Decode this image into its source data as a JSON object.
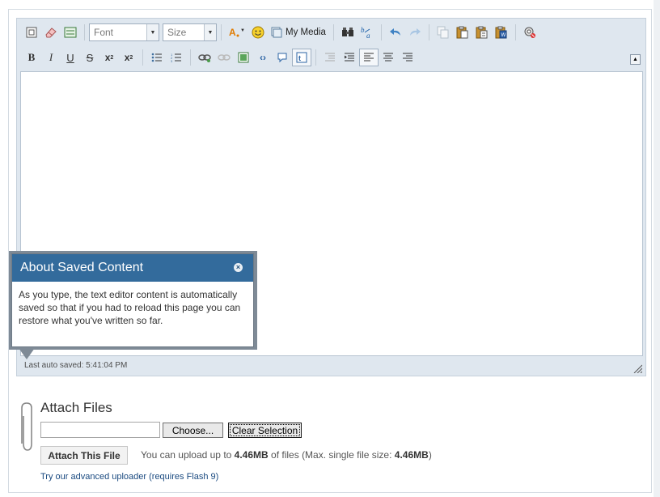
{
  "toolbar": {
    "font_label": "Font",
    "size_label": "Size",
    "my_media_label": "My Media",
    "row1_icons": [
      "source-icon",
      "eraser-icon",
      "template-icon",
      "text-color-icon",
      "smiley-icon",
      "find-icon",
      "spellcheck-icon",
      "undo-icon",
      "redo-icon",
      "copy-icon",
      "paste-icon",
      "paste-text-icon",
      "paste-word-icon",
      "settings-icon"
    ],
    "row2_icons": [
      "bold-icon",
      "italic-icon",
      "underline-icon",
      "strikethrough-icon",
      "subscript-icon",
      "superscript-icon",
      "bullet-list-icon",
      "numbered-list-icon",
      "link-icon",
      "unlink-icon",
      "image-icon",
      "code-icon",
      "quote-icon",
      "preview-icon",
      "outdent-icon",
      "indent-icon",
      "align-left-icon",
      "align-center-icon",
      "align-right-icon"
    ]
  },
  "editor": {
    "status": "Last auto saved: 5:41:04 PM"
  },
  "popup": {
    "title": "About Saved Content",
    "close": "×",
    "body": "As you type, the text editor content is automatically saved so that if you had to reload this page you can restore what you've written so far."
  },
  "attach": {
    "title": "Attach Files",
    "file_value": "",
    "choose_label": "Choose...",
    "clear_label": "Clear Selection",
    "attach_button_label": "Attach This File",
    "info_prefix": "You can upload up to",
    "info_size": "4.46MB",
    "info_middle": "of files (Max. single file size:",
    "info_max": "4.46MB",
    "info_suffix": ")",
    "advanced_link": "Try our advanced uploader (requires Flash 9)"
  }
}
